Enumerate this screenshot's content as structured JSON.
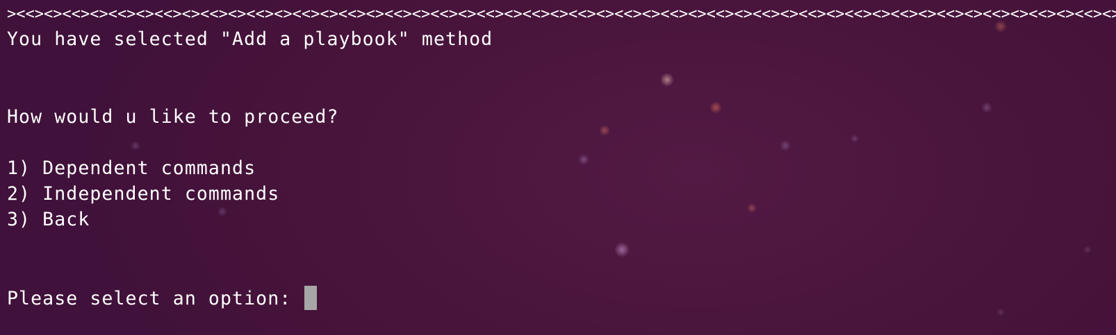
{
  "terminal": {
    "separator": "><<><><<><><<><><<><><<><><<><><<><><<><><<><><<><><<><><<><><<><><<><><<><><<><><<><><<><><<><><<><><<><><<><><<><><<><><<><><<><><<><><<><><<><><<><><<><><<><><<><><<><><<><><<><><<><><<><><<",
    "selected_message": "You have selected \"Add a playbook\" method",
    "question": "How would u like to proceed?",
    "options": [
      "1) Dependent commands",
      "2) Independent commands",
      "3) Back"
    ],
    "prompt": "Please select an option: ",
    "input_value": ""
  }
}
